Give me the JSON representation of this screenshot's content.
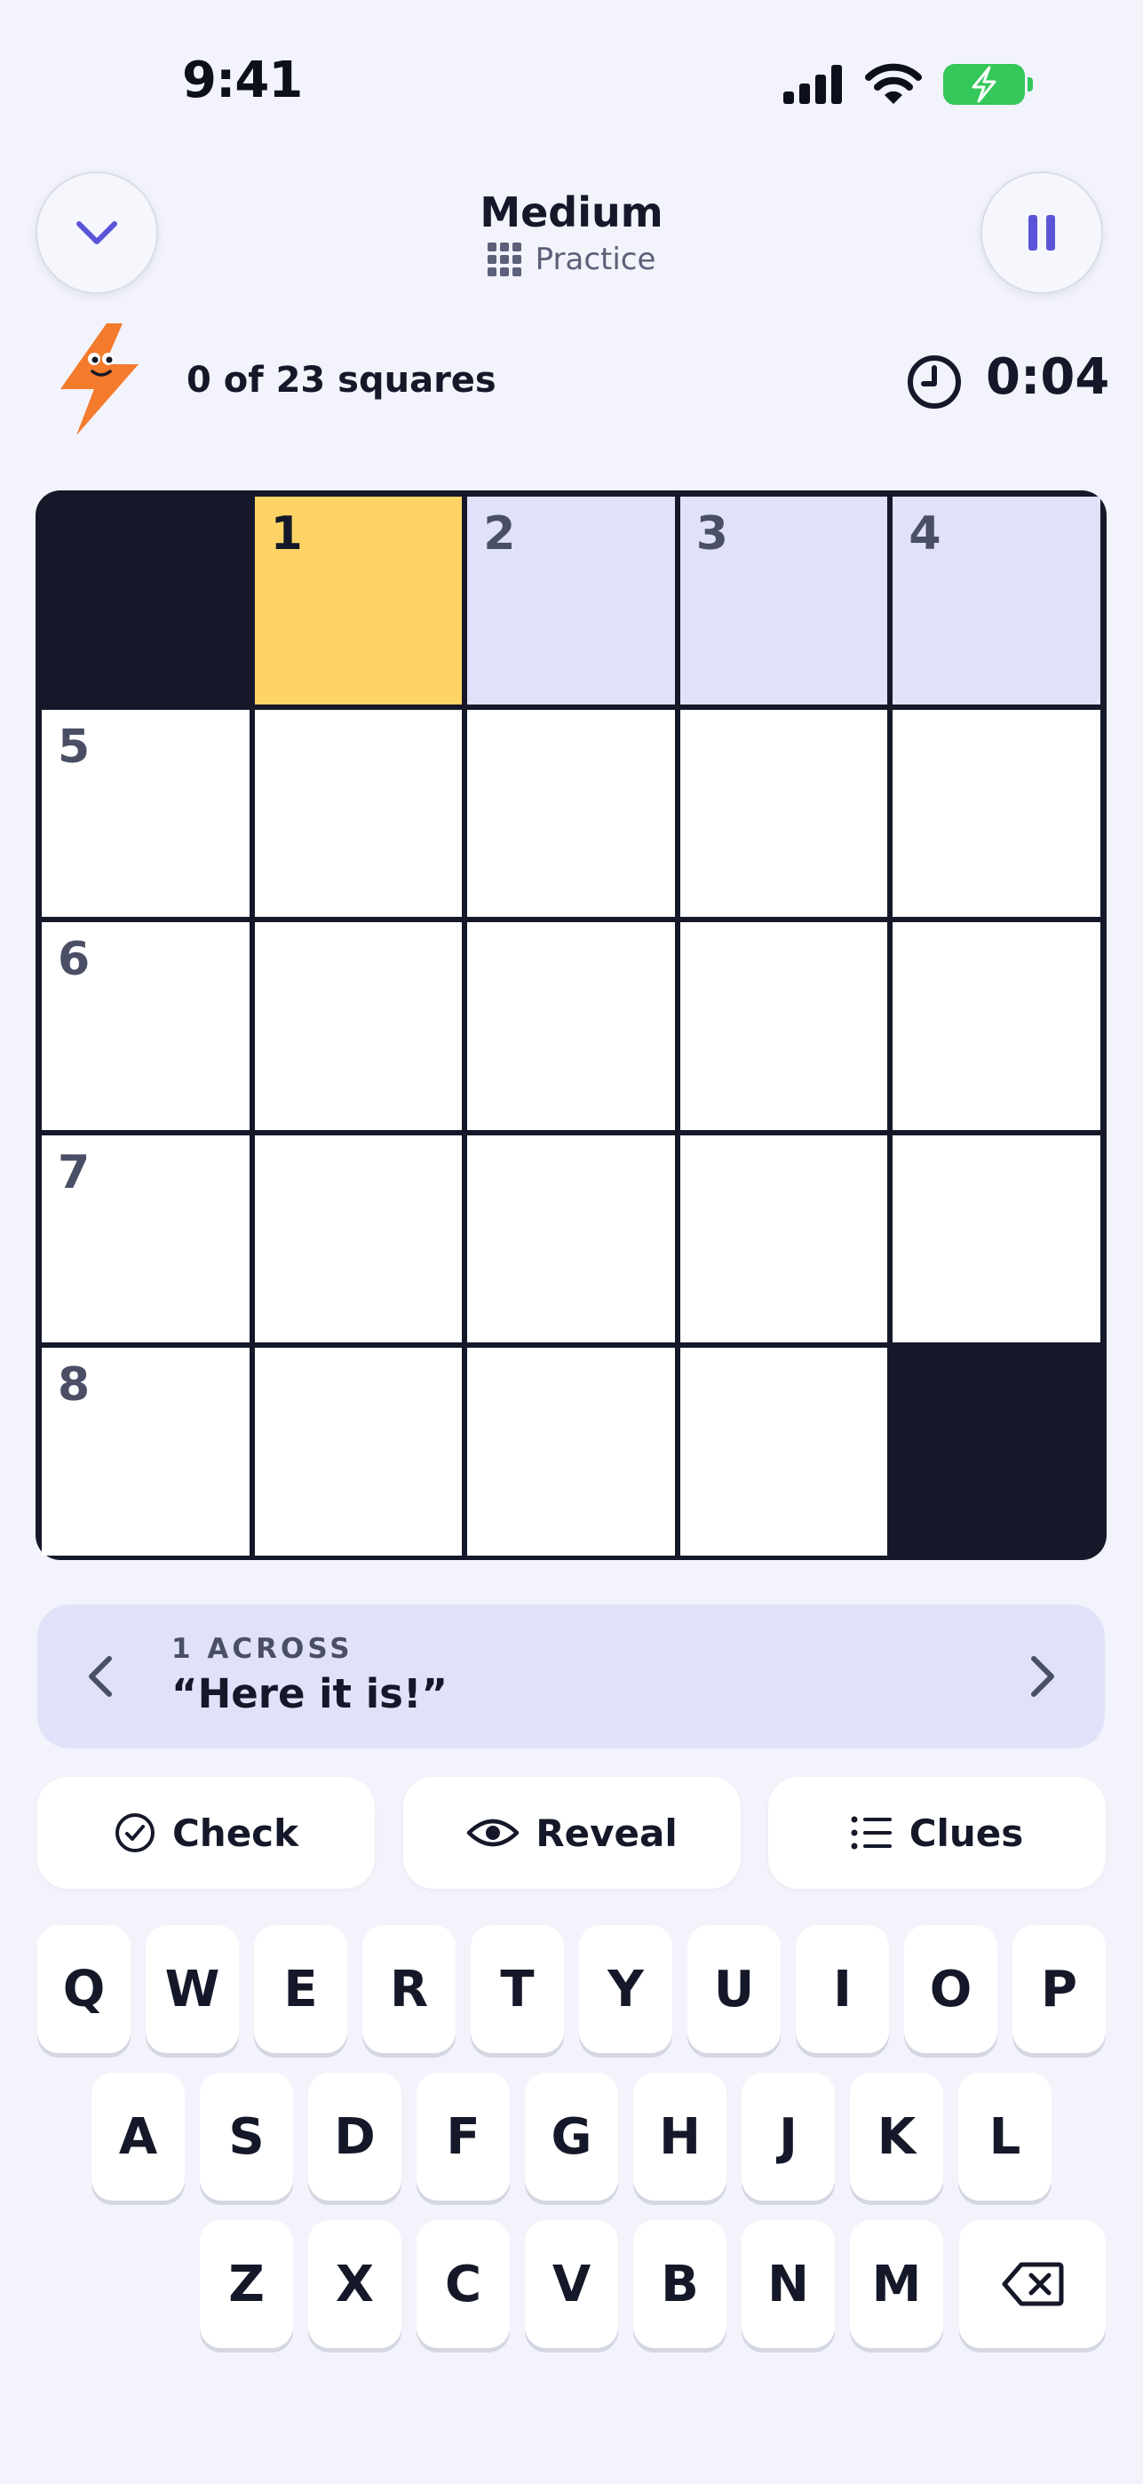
{
  "status_bar": {
    "time": "9:41"
  },
  "header": {
    "title": "Medium",
    "subtitle": "Practice"
  },
  "progress": {
    "squares_text": "0 of 23 squares",
    "timer": "0:04"
  },
  "puzzle": {
    "rows": 5,
    "cols": 5,
    "cells": [
      [
        {
          "block": true
        },
        {
          "num": "1",
          "state": "active"
        },
        {
          "num": "2",
          "state": "word"
        },
        {
          "num": "3",
          "state": "word"
        },
        {
          "num": "4",
          "state": "word"
        }
      ],
      [
        {
          "num": "5"
        },
        {},
        {},
        {},
        {}
      ],
      [
        {
          "num": "6"
        },
        {},
        {},
        {},
        {}
      ],
      [
        {
          "num": "7"
        },
        {},
        {},
        {},
        {}
      ],
      [
        {
          "num": "8"
        },
        {},
        {},
        {},
        {
          "block": true
        }
      ]
    ]
  },
  "clue": {
    "label": "1 ACROSS",
    "text": "“Here it is!”"
  },
  "actions": {
    "check": "Check",
    "reveal": "Reveal",
    "clues": "Clues"
  },
  "keyboard": {
    "row1": [
      "Q",
      "W",
      "E",
      "R",
      "T",
      "Y",
      "U",
      "I",
      "O",
      "P"
    ],
    "row2": [
      "A",
      "S",
      "D",
      "F",
      "G",
      "H",
      "J",
      "K",
      "L"
    ],
    "row3": [
      "Z",
      "X",
      "C",
      "V",
      "B",
      "N",
      "M"
    ]
  },
  "icons": {
    "collapse": "chevron-down-icon",
    "pause": "pause-icon",
    "mascot": "lightning-bolt-icon",
    "timer": "clock-icon",
    "backspace": "backspace-icon"
  },
  "colors": {
    "background": "#f2f3fb",
    "accent": "#5a55d8",
    "active_cell": "#ffd466",
    "word_highlight": "#e0e2fa",
    "grid": "#151829",
    "mascot": "#f47a2c"
  }
}
